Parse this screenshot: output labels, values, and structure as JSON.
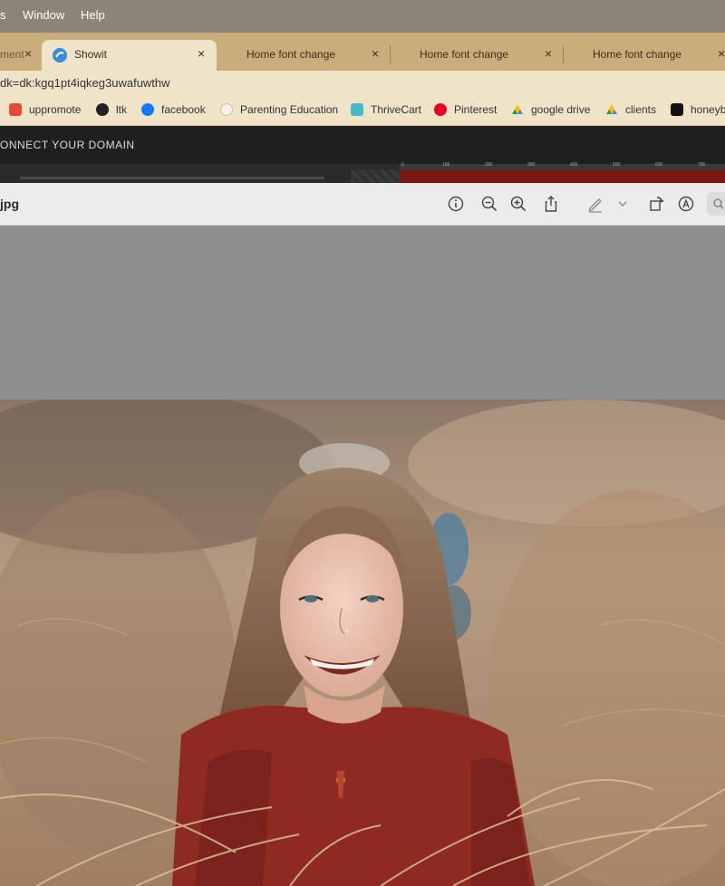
{
  "menubar": {
    "items": [
      "s",
      "Window",
      "Help"
    ]
  },
  "tabs": [
    {
      "label": "ment",
      "close": "×"
    },
    {
      "label": "Showit",
      "close": "×",
      "active": true
    },
    {
      "label": "Home font change",
      "close": "×"
    },
    {
      "label": "Home font change",
      "close": "×"
    },
    {
      "label": "Home font change",
      "close": "×"
    }
  ],
  "addressbar": {
    "url": "dk=dk:kgq1pt4iqkeg3uwafuwthw"
  },
  "bookmarks": [
    {
      "label": "uppromote",
      "icon": "uppromote-icon"
    },
    {
      "label": "ltk",
      "icon": "ltk-icon"
    },
    {
      "label": "facebook",
      "icon": "facebook-icon"
    },
    {
      "label": "Parenting Education",
      "icon": "parenting-education-icon"
    },
    {
      "label": "ThriveCart",
      "icon": "thrivecart-icon"
    },
    {
      "label": "Pinterest",
      "icon": "pinterest-icon"
    },
    {
      "label": "google drive",
      "icon": "google-drive-icon"
    },
    {
      "label": "clients",
      "icon": "google-drive-icon"
    },
    {
      "label": "honeyb",
      "icon": "honeybook-icon"
    }
  ],
  "app": {
    "header_title": "ONNECT YOUR DOMAIN"
  },
  "ruler": {
    "ticks": [
      "0",
      "100",
      "200",
      "300",
      "400",
      "500",
      "600",
      "700"
    ]
  },
  "preview": {
    "filename": "jpg",
    "toolbar": [
      "info-icon",
      "zoom-out-icon",
      "zoom-in-icon",
      "share-icon",
      "markup-pen-icon",
      "chevron-down-icon",
      "rotate-icon",
      "annotate-icon",
      "search-icon"
    ]
  },
  "colors": {
    "menubar": "#8b8578",
    "tabstrip": "#c9ae7b",
    "tab_active": "#efe3c8",
    "app_header": "#1f1f1f",
    "preview_toolbar": "#ececec",
    "preview_background": "#8f8f8f",
    "sweater": "#8e2a22"
  }
}
